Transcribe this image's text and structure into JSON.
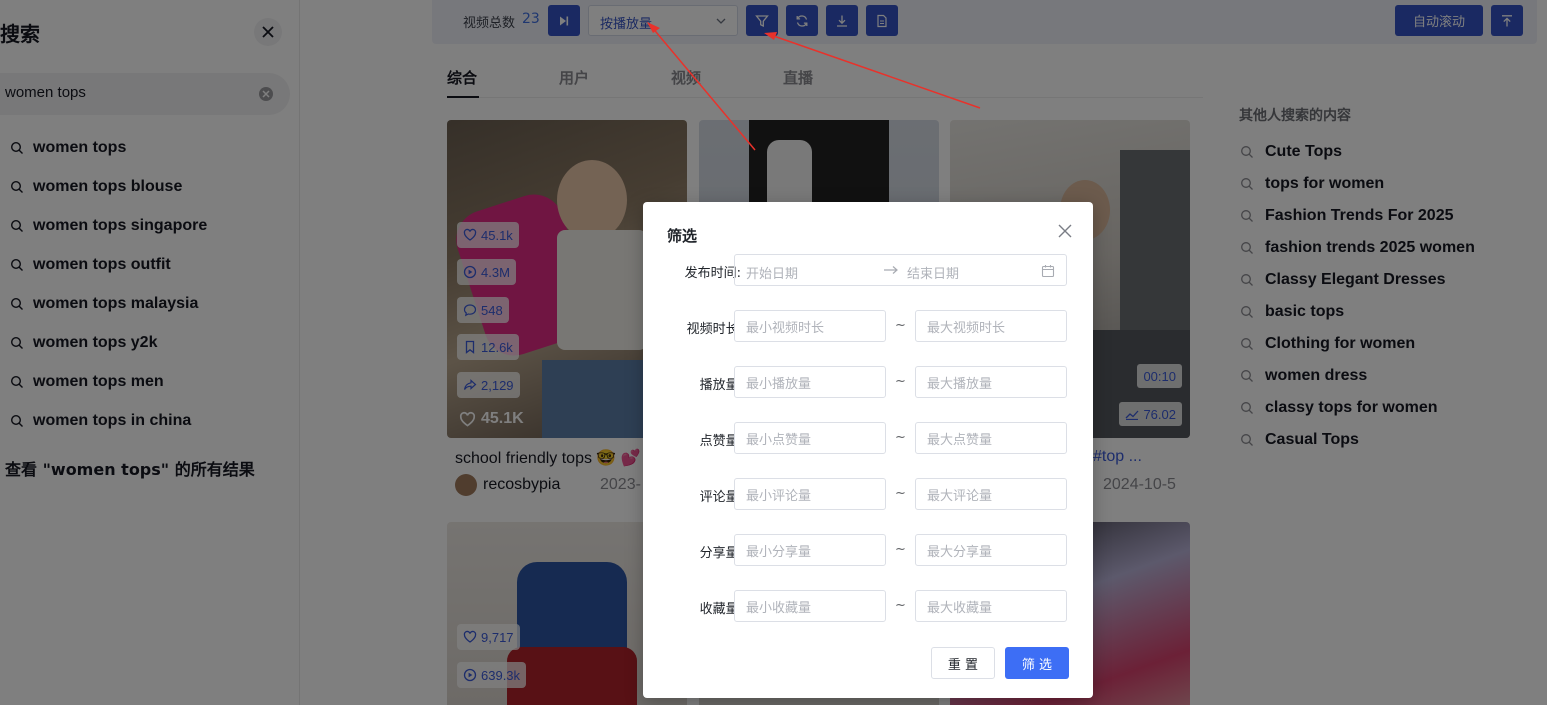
{
  "left_panel": {
    "title": "搜索",
    "search_value": "women tops",
    "suggestions": [
      "women tops",
      "women tops blouse",
      "women tops singapore",
      "women tops outfit",
      "women tops malaysia",
      "women tops y2k",
      "women tops men",
      "women tops in china"
    ],
    "see_all": "查看 \"women tops\" 的所有结果"
  },
  "toolbar": {
    "total_label": "视频总数",
    "total_count": "23",
    "sort_value": "按播放量",
    "auto_scroll_label": "自动滚动"
  },
  "tabs": [
    "综合",
    "用户",
    "视频",
    "直播"
  ],
  "cards": [
    {
      "likes": "45.1k",
      "plays": "4.3M",
      "comments": "548",
      "saves": "12.6k",
      "shares": "2,129",
      "like_big": "45.1K",
      "title": "school friendly tops 🤓 💕",
      "author": "recosbypia",
      "date": "2023-"
    },
    {
      "duration": "00:10",
      "score": "76.02",
      "title_tail": "#top ...",
      "date": "2024-10-5"
    },
    {
      "likes": "9,717",
      "plays": "639.3k"
    }
  ],
  "related": {
    "title": "其他人搜索的内容",
    "items": [
      "Cute Tops",
      "tops for women",
      "Fashion Trends For 2025",
      "fashion trends 2025 women",
      "Classy Elegant Dresses",
      "basic tops",
      "Clothing for women",
      "women dress",
      "classy tops for women",
      "Casual Tops"
    ]
  },
  "dialog": {
    "title": "筛选",
    "publish_time_label": "发布时间:",
    "start_date_placeholder": "开始日期",
    "end_date_placeholder": "结束日期",
    "rows": [
      {
        "label": "视频时长:",
        "min": "最小视频时长",
        "max": "最大视频时长"
      },
      {
        "label": "播放量:",
        "min": "最小播放量",
        "max": "最大播放量"
      },
      {
        "label": "点赞量:",
        "min": "最小点赞量",
        "max": "最大点赞量"
      },
      {
        "label": "评论量:",
        "min": "最小评论量",
        "max": "最大评论量"
      },
      {
        "label": "分享量:",
        "min": "最小分享量",
        "max": "最大分享量"
      },
      {
        "label": "收藏量:",
        "min": "最小收藏量",
        "max": "最大收藏量"
      }
    ],
    "tilde": "~",
    "reset_label": "重 置",
    "filter_label": "筛 选"
  },
  "colors": {
    "accent": "#3553c4",
    "primary_button": "#3d6ef5",
    "annotation_arrow": "#e8322b"
  }
}
